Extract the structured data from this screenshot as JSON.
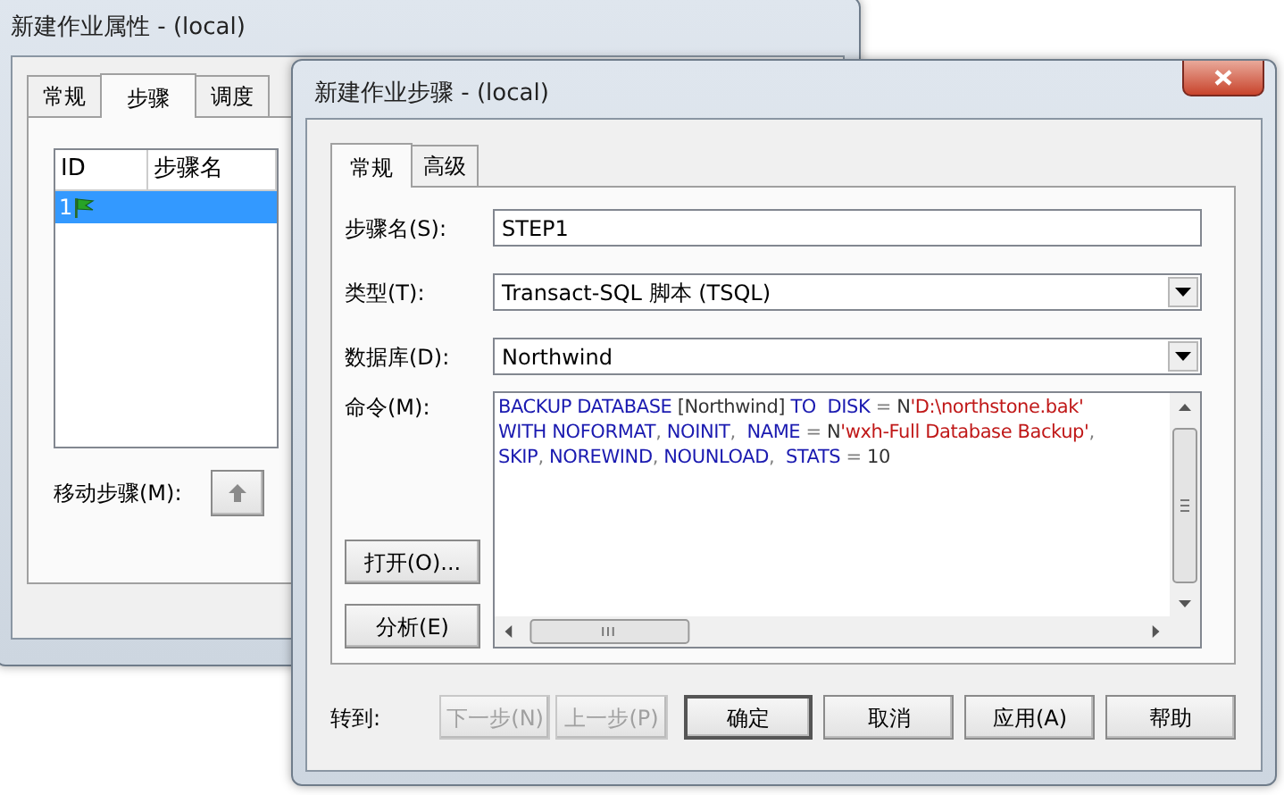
{
  "back_window": {
    "title": "新建作业属性 - (local)",
    "tabs": [
      {
        "label": "常规",
        "selected": false
      },
      {
        "label": "步骤",
        "selected": true
      },
      {
        "label": "调度",
        "selected": false
      }
    ],
    "steps_table": {
      "columns": [
        "ID",
        "步骤名"
      ],
      "rows": [
        {
          "id": "1",
          "selected": true
        }
      ]
    },
    "move_label": "移动步骤(M):"
  },
  "step_dialog": {
    "title": "新建作业步骤 - (local)",
    "tabs": [
      {
        "label": "常规",
        "selected": true
      },
      {
        "label": "高级",
        "selected": false
      }
    ],
    "fields": [
      {
        "label": "步骤名(S):",
        "value": "STEP1",
        "kind": "text"
      },
      {
        "label": "类型(T):",
        "value": "Transact-SQL 脚本 (TSQL)",
        "kind": "select"
      },
      {
        "label": "数据库(D):",
        "value": "Northwind",
        "kind": "select"
      }
    ],
    "command_label": "命令(M):",
    "command_lines": [
      [
        {
          "text": "BACKUP DATABASE",
          "kind": "keyword"
        },
        {
          "text": " [Northwind] ",
          "kind": "plain"
        },
        {
          "text": "TO  DISK",
          "kind": "keyword"
        },
        {
          "text": " = ",
          "kind": "operator"
        },
        {
          "text": "N",
          "kind": "plain"
        },
        {
          "text": "'D:\\northstone.bak'",
          "kind": "string"
        }
      ],
      [
        {
          "text": "WITH NOFORMAT",
          "kind": "keyword"
        },
        {
          "text": ", ",
          "kind": "operator"
        },
        {
          "text": "NOINIT",
          "kind": "keyword"
        },
        {
          "text": ",  ",
          "kind": "operator"
        },
        {
          "text": "NAME",
          "kind": "keyword"
        },
        {
          "text": " = ",
          "kind": "operator"
        },
        {
          "text": "N",
          "kind": "plain"
        },
        {
          "text": "'wxh-Full Database Backup'",
          "kind": "string"
        },
        {
          "text": ",",
          "kind": "operator"
        }
      ],
      [
        {
          "text": "SKIP",
          "kind": "keyword"
        },
        {
          "text": ", ",
          "kind": "operator"
        },
        {
          "text": "NOREWIND",
          "kind": "keyword"
        },
        {
          "text": ", ",
          "kind": "operator"
        },
        {
          "text": "NOUNLOAD",
          "kind": "keyword"
        },
        {
          "text": ",  ",
          "kind": "operator"
        },
        {
          "text": "STATS",
          "kind": "keyword"
        },
        {
          "text": " = ",
          "kind": "operator"
        },
        {
          "text": "10",
          "kind": "plain"
        }
      ]
    ],
    "side_buttons": [
      "打开(O)...",
      "分析(E)"
    ],
    "goto_label": "转到:",
    "nav_buttons": [
      {
        "label": "下一步(N)",
        "disabled": true
      },
      {
        "label": "上一步(P)",
        "disabled": true
      }
    ],
    "footer_buttons": [
      {
        "label": "确定",
        "default": true
      },
      {
        "label": "取消",
        "default": false
      },
      {
        "label": "应用(A)",
        "default": false
      },
      {
        "label": "帮助",
        "default": false
      }
    ]
  }
}
